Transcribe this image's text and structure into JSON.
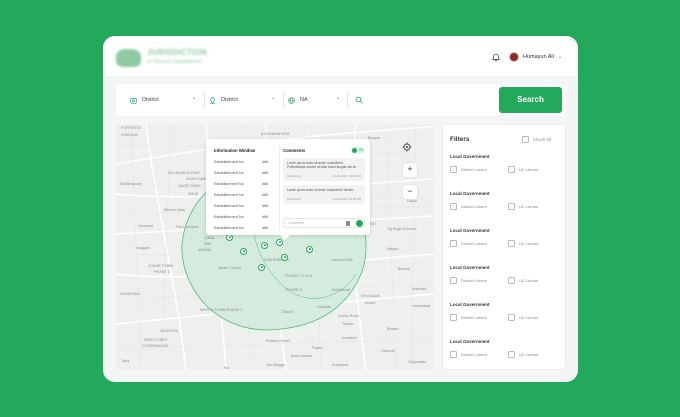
{
  "brand": {
    "title": "JURISDICTION",
    "subtitle": "of Various Department"
  },
  "user": {
    "name": "Humayun Ali"
  },
  "search": {
    "district_1": "District",
    "district_2": "District",
    "third_select": "NA",
    "button_label": "Search"
  },
  "map": {
    "places": [
      "FORTRESS",
      "STADIUM",
      "BAGHBANPURA",
      "GULSHAN-E-RAVI",
      "SHAH KAMAL",
      "JAVED PARK",
      "RACE",
      "Sheikhupura",
      "Sarmand",
      "Allama Iqbal",
      "Town",
      "IQBAL",
      "SBB",
      "AMANA",
      "Harbanspura",
      "Lalpur",
      "DHAI",
      "Ravi Campus",
      "DHA EAST",
      "Taj Bagh Scheme",
      "Wagah",
      "Bharoa",
      "Manwan",
      "Hastenbad",
      "Saggian",
      "JOHAR TOWN",
      "PHASE 1",
      "SHADEWAL",
      "Model Colony",
      "DHA PHASE 5",
      "Lahore DHA",
      "PHASE 7 D.H.A",
      "WAPDA TOWN PHASE 1",
      "PHASE 6",
      "Sera Daudi",
      "Mirani",
      "Bhasin",
      "EMPLOYEES",
      "COOPERATIVE",
      "Mohlanwal",
      "Kacha Road",
      "Hospital",
      "Dharki",
      "Thakar",
      "Kandwal",
      "VALENCIA",
      "Tariq",
      "Raiwind Road",
      "Pajian",
      "Tha",
      "Jiya Bagga",
      "Bara Nathan",
      "Hallouki",
      "Khanpura",
      "Gajjumatta",
      "Bhupal"
    ],
    "zoom_in": "+",
    "zoom_out": "−"
  },
  "info_window": {
    "title": "Information Window",
    "rows": [
      {
        "label": "Establishment No",
        "value": "#66"
      },
      {
        "label": "Establishment No",
        "value": "#66"
      },
      {
        "label": "Establishment No",
        "value": "#66"
      },
      {
        "label": "Establishment No",
        "value": "#66"
      },
      {
        "label": "Establishment No",
        "value": "#66"
      },
      {
        "label": "Establishment No",
        "value": "#66"
      },
      {
        "label": "Establishment No",
        "value": "#66"
      }
    ],
    "comments_title": "Comments",
    "comments_count": "03",
    "comments": [
      {
        "text": "Lorem ipsum dolor sit amet consectetur. Pellentesque laoreet at vitae fusce feugiat nisi eu",
        "author": "Maria Khan",
        "date": "12-10-2023 | 04:00 PM"
      },
      {
        "text": "Lorem ipsum dolor sit amet consectetur ultrices",
        "author": "Maria Khan",
        "date": "12-10-2023 | 04:00 PM"
      }
    ],
    "comment_placeholder": "Comment"
  },
  "filters": {
    "title": "Filters",
    "check_all": "Check All",
    "groups": [
      {
        "title": "Local Government",
        "opt1": "District Lahore",
        "opt2": "UC Lahore"
      },
      {
        "title": "Local Government",
        "opt1": "District Lahore",
        "opt2": "UC Lahore"
      },
      {
        "title": "Local Government",
        "opt1": "District Lahore",
        "opt2": "UC Lahore"
      },
      {
        "title": "Local Government",
        "opt1": "District Lahore",
        "opt2": "UC Lahore"
      },
      {
        "title": "Local Government",
        "opt1": "District Lahore",
        "opt2": "UC Lahore"
      },
      {
        "title": "Local Government",
        "opt1": "District Lahore",
        "opt2": "UC Lahore"
      }
    ]
  },
  "colors": {
    "brand_green": "#22a95b",
    "zone_fill": "#cfead9"
  },
  "icons": [
    "bell-icon",
    "avatar",
    "chevron-down-icon",
    "district-icon",
    "location-icon",
    "search-icon",
    "target-icon",
    "marker-icon",
    "attach-icon",
    "send-icon"
  ]
}
